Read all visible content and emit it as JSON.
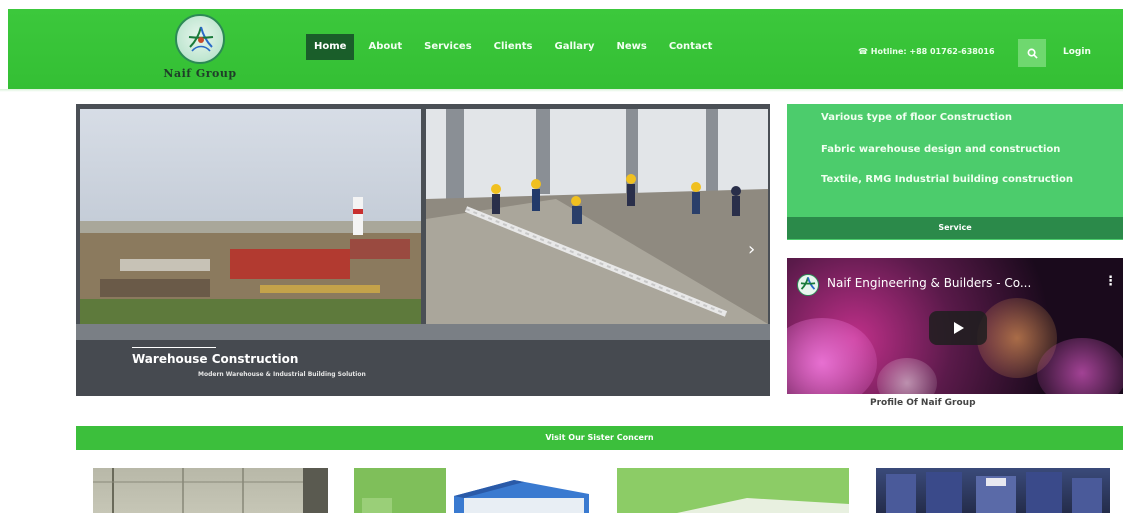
{
  "brand": {
    "name": "Naif Group"
  },
  "nav": {
    "items": [
      {
        "label": "Home",
        "active": true
      },
      {
        "label": "About",
        "active": false
      },
      {
        "label": "Services",
        "active": false
      },
      {
        "label": "Clients",
        "active": false
      },
      {
        "label": "Gallary",
        "active": false
      },
      {
        "label": "News",
        "active": false
      },
      {
        "label": "Contact",
        "active": false
      }
    ],
    "hotline": "Hotline: +88 01762-638016",
    "login_label": "Login",
    "search_icon": "search-icon"
  },
  "slider": {
    "caption_title": "Warehouse Construction",
    "caption_subtitle": "Modern Warehouse & Industrial Building Solution",
    "next_icon": "chevron-right-icon"
  },
  "services": {
    "items": [
      "Various type of floor Construction",
      "Fabric warehouse design and construction",
      "Textile, RMG Industrial building construction"
    ],
    "footer_label": "Service"
  },
  "video": {
    "title": "Naif Engineering & Builders - Co...",
    "caption": "Profile Of Naif Group"
  },
  "sister": {
    "heading": "Visit Our Sister Concern"
  },
  "colors": {
    "header_green": "#3cc83c",
    "nav_active": "#1a5e2a",
    "services_green": "#4ccc6c",
    "services_footer": "#2b8a4a",
    "slider_caption_bg": "#464a50"
  }
}
